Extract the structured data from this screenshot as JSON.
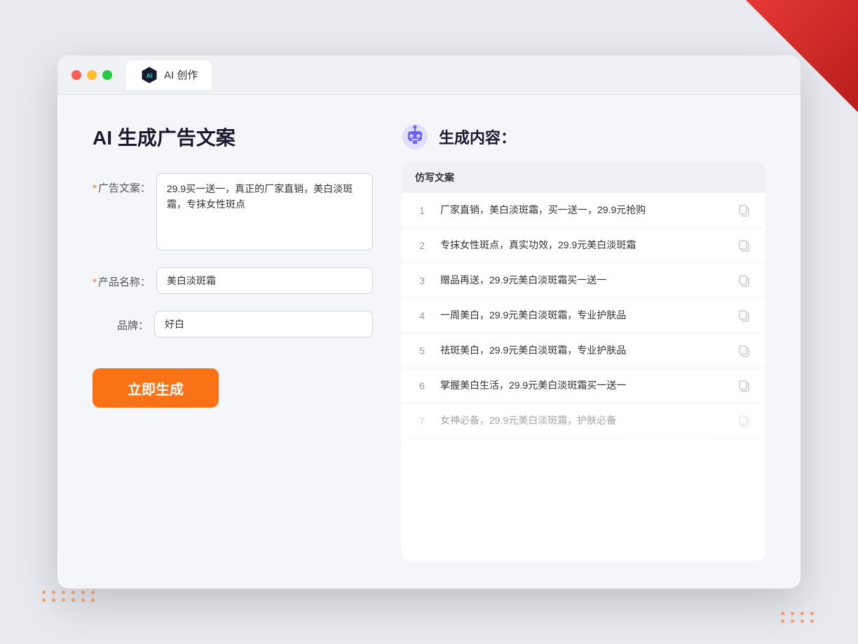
{
  "window": {
    "tab_label": "AI 创作",
    "controls": [
      "red",
      "yellow",
      "green"
    ]
  },
  "left_panel": {
    "title": "AI 生成广告文案",
    "form": {
      "ad_copy_label": "广告文案：",
      "ad_copy_required": "*",
      "ad_copy_value": "29.9买一送一，真正的厂家直销，美白淡斑霜，专抹女性斑点",
      "product_name_label": "产品名称：",
      "product_name_required": "*",
      "product_name_value": "美白淡斑霜",
      "brand_label": "品牌：",
      "brand_value": "好白"
    },
    "generate_button": "立即生成"
  },
  "right_panel": {
    "title": "生成内容：",
    "table_header": "仿写文案",
    "results": [
      {
        "num": "1",
        "text": "厂家直销，美白淡斑霜，买一送一，29.9元抢购",
        "faded": false
      },
      {
        "num": "2",
        "text": "专抹女性斑点，真实功效，29.9元美白淡斑霜",
        "faded": false
      },
      {
        "num": "3",
        "text": "赠品再送，29.9元美白淡斑霜买一送一",
        "faded": false
      },
      {
        "num": "4",
        "text": "一周美白，29.9元美白淡斑霜，专业护肤品",
        "faded": false
      },
      {
        "num": "5",
        "text": "祛斑美白，29.9元美白淡斑霜，专业护肤品",
        "faded": false
      },
      {
        "num": "6",
        "text": "掌握美白生活，29.9元美白淡斑霜买一送一",
        "faded": false
      },
      {
        "num": "7",
        "text": "女神必备，29.9元美白淡斑霜，护肤必备",
        "faded": true
      }
    ]
  }
}
